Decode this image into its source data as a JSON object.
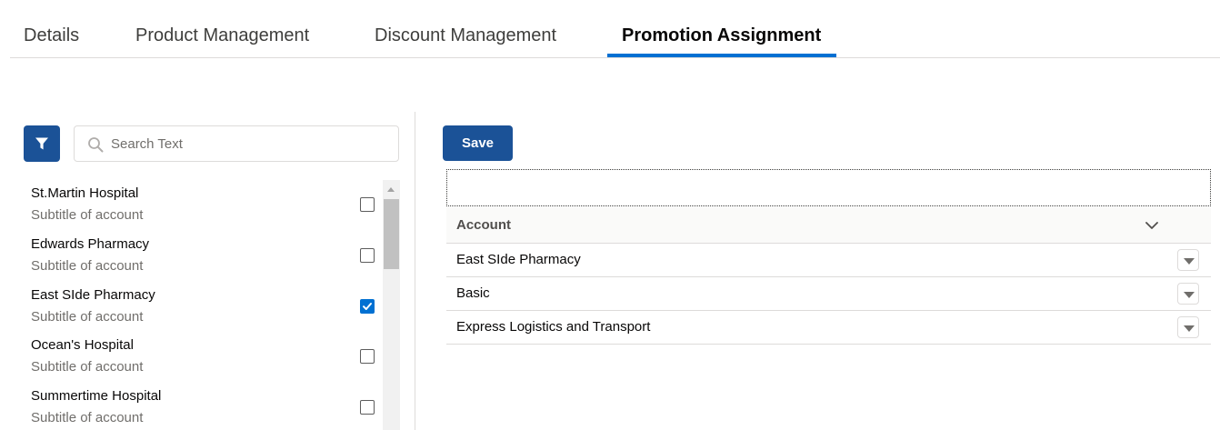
{
  "tabs": [
    {
      "label": "Details"
    },
    {
      "label": "Product Management"
    },
    {
      "label": "Discount Management"
    },
    {
      "label": "Promotion Assignment",
      "active": true
    }
  ],
  "left_panel": {
    "filter_icon": "filter-icon",
    "search": {
      "placeholder": "Search Text",
      "value": "",
      "icon": "search-icon"
    },
    "accounts": [
      {
        "title": "St.Martin Hospital",
        "subtitle": "Subtitle of account",
        "checked": false
      },
      {
        "title": "Edwards Pharmacy",
        "subtitle": "Subtitle of account",
        "checked": false
      },
      {
        "title": "East SIde Pharmacy",
        "subtitle": "Subtitle of account",
        "checked": true
      },
      {
        "title": "Ocean's Hospital",
        "subtitle": "Subtitle of account",
        "checked": false
      },
      {
        "title": "Summertime Hospital",
        "subtitle": "Subtitle of account",
        "checked": false
      }
    ]
  },
  "right_panel": {
    "save_label": "Save",
    "grid": {
      "column_header": "Account",
      "rows": [
        {
          "account": "East SIde Pharmacy"
        },
        {
          "account": "Basic"
        },
        {
          "account": "Express Logistics and Transport"
        }
      ]
    }
  },
  "colors": {
    "accent": "#0070d2",
    "brand_button": "#1b5297",
    "border": "#dddbda",
    "subtitle_text": "#706e6b"
  }
}
